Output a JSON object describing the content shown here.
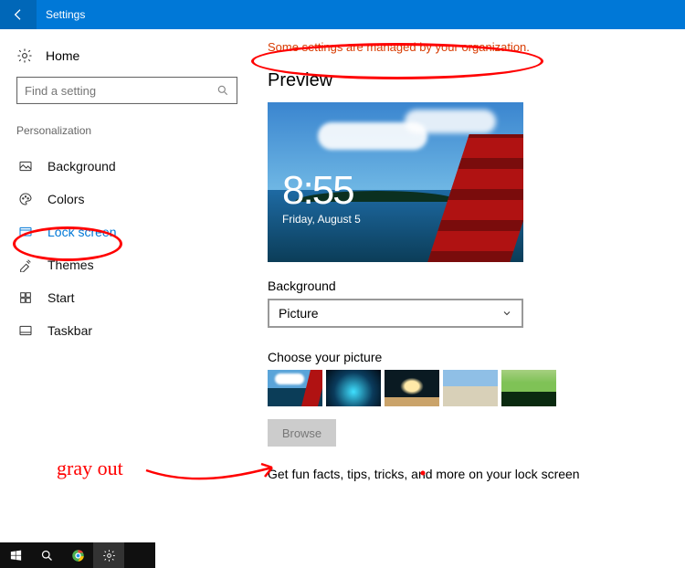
{
  "titlebar": {
    "app_name": "Settings"
  },
  "sidebar": {
    "home_label": "Home",
    "search_placeholder": "Find a setting",
    "category": "Personalization",
    "items": [
      {
        "label": "Background"
      },
      {
        "label": "Colors"
      },
      {
        "label": "Lock screen",
        "selected": true
      },
      {
        "label": "Themes"
      },
      {
        "label": "Start"
      },
      {
        "label": "Taskbar"
      }
    ]
  },
  "content": {
    "org_message": "Some settings are managed by your organization.",
    "preview_heading": "Preview",
    "preview_clock": {
      "time": "8:55",
      "date": "Friday, August 5"
    },
    "background_label": "Background",
    "background_value": "Picture",
    "choose_label": "Choose your picture",
    "browse_label": "Browse",
    "funfact_label": "Get fun facts, tips, tricks, and more on your lock screen"
  },
  "annotations": {
    "gray_out_text": "gray out"
  }
}
